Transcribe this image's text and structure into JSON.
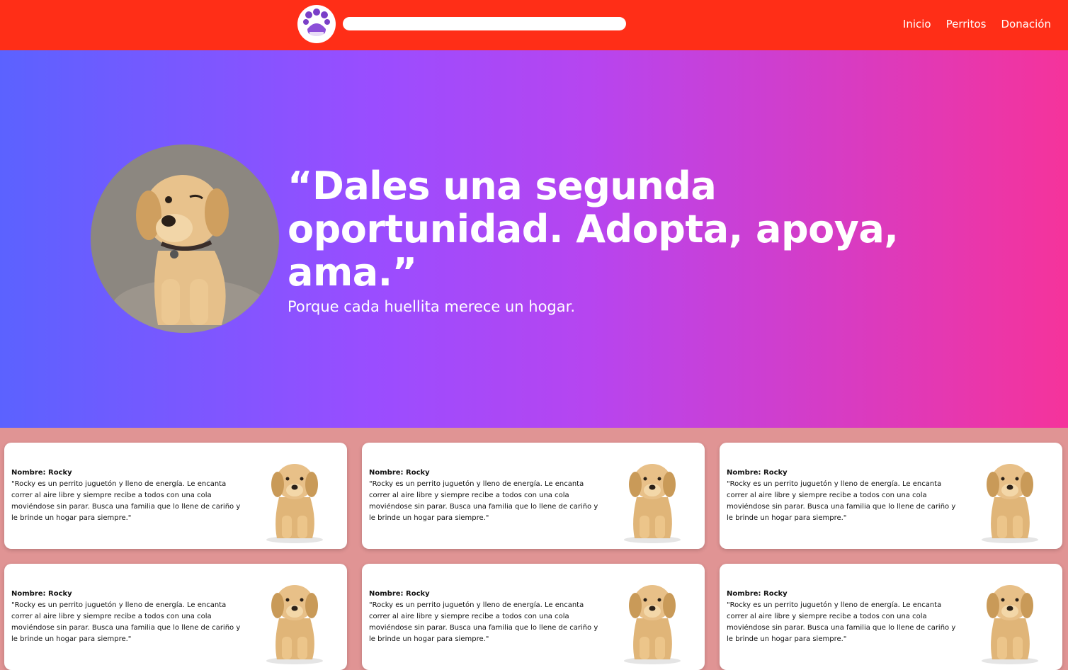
{
  "brand": {
    "logo_name": "paw-logo"
  },
  "search": {
    "placeholder": ""
  },
  "nav": {
    "items": [
      {
        "label": "Inicio"
      },
      {
        "label": "Perritos"
      },
      {
        "label": "Donación"
      }
    ]
  },
  "hero": {
    "quote": "“Dales una segunda oportunidad. Adopta, apoya, ama.”",
    "subtitle": "Porque cada huellita merece un hogar."
  },
  "cards": [
    {
      "name": "Nombre: Rocky",
      "description": "\"Rocky es un perrito juguetón y lleno de energía. Le encanta correr al aire libre y siempre recibe a todos con una cola moviéndose sin parar. Busca una familia que lo llene de cariño y le brinde un hogar para siempre.\""
    },
    {
      "name": "Nombre: Rocky",
      "description": "\"Rocky es un perrito juguetón y lleno de energía. Le encanta correr al aire libre y siempre recibe a todos con una cola moviéndose sin parar. Busca una familia que lo llene de cariño y le brinde un hogar para siempre.\""
    },
    {
      "name": "Nombre: Rocky",
      "description": "\"Rocky es un perrito juguetón y lleno de energía. Le encanta correr al aire libre y siempre recibe a todos con una cola moviéndose sin parar. Busca una familia que lo llene de cariño y le brinde un hogar para siempre.\""
    },
    {
      "name": "Nombre: Rocky",
      "description": "\"Rocky es un perrito juguetón y lleno de energía. Le encanta correr al aire libre y siempre recibe a todos con una cola moviéndose sin parar. Busca una familia que lo llene de cariño y le brinde un hogar para siempre.\""
    },
    {
      "name": "Nombre: Rocky",
      "description": "\"Rocky es un perrito juguetón y lleno de energía. Le encanta correr al aire libre y siempre recibe a todos con una cola moviéndose sin parar. Busca una familia que lo llene de cariño y le brinde un hogar para siempre.\""
    },
    {
      "name": "Nombre: Rocky",
      "description": "\"Rocky es un perrito juguetón y lleno de energía. Le encanta correr al aire libre y siempre recibe a todos con una cola moviéndose sin parar. Busca una familia que lo llene de cariño y le brinde un hogar para siempre.\""
    }
  ],
  "colors": {
    "navbar": "#ff2e17",
    "page_background": "#e09494",
    "hero_gradient_start": "#5b62ff",
    "hero_gradient_end": "#f5339b"
  }
}
